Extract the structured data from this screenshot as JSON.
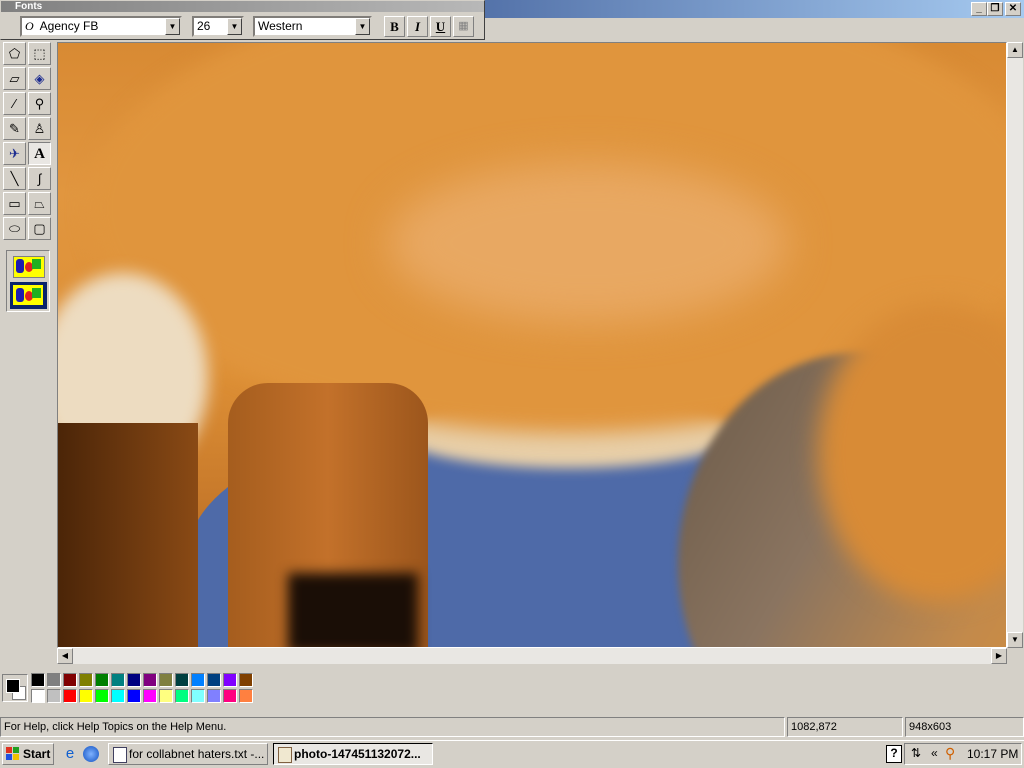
{
  "window": {
    "menu_first_letter": "F",
    "min_symbol": "_",
    "restore_symbol": "❐",
    "close_symbol": "✕"
  },
  "fonts_toolbar": {
    "title": "Fonts",
    "font_icon": "O",
    "font_name": "Agency FB",
    "font_size": "26",
    "script": "Western",
    "bold_label": "B",
    "italic_label": "I",
    "underline_label": "U"
  },
  "toolbox": {
    "tools": [
      {
        "name": "free-form-select-icon",
        "glyph": "⬠"
      },
      {
        "name": "rect-select-icon",
        "glyph": "⬚"
      },
      {
        "name": "eraser-icon",
        "glyph": "▱"
      },
      {
        "name": "fill-bucket-icon",
        "glyph": "◈"
      },
      {
        "name": "color-picker-icon",
        "glyph": "⁄"
      },
      {
        "name": "magnifier-icon",
        "glyph": "⚲"
      },
      {
        "name": "pencil-icon",
        "glyph": "✎"
      },
      {
        "name": "brush-icon",
        "glyph": "♙"
      },
      {
        "name": "airbrush-icon",
        "glyph": "✈"
      },
      {
        "name": "text-icon",
        "glyph": "A"
      },
      {
        "name": "line-icon",
        "glyph": "╲"
      },
      {
        "name": "curve-icon",
        "glyph": "∫"
      },
      {
        "name": "rectangle-icon",
        "glyph": "▭"
      },
      {
        "name": "polygon-icon",
        "glyph": "⏢"
      },
      {
        "name": "ellipse-icon",
        "glyph": "⬭"
      },
      {
        "name": "rounded-rect-icon",
        "glyph": "▢"
      }
    ],
    "active_tool": "text-icon"
  },
  "colors": {
    "primary": "#000000",
    "secondary": "#ffffff",
    "palette_row1": [
      "#000000",
      "#808080",
      "#800000",
      "#808000",
      "#008000",
      "#008080",
      "#000080",
      "#800080",
      "#808040",
      "#004040",
      "#0080ff",
      "#004080",
      "#8000ff",
      "#804000"
    ],
    "palette_row2": [
      "#ffffff",
      "#c0c0c0",
      "#ff0000",
      "#ffff00",
      "#00ff00",
      "#00ffff",
      "#0000ff",
      "#ff00ff",
      "#ffff80",
      "#00ff80",
      "#80ffff",
      "#8080ff",
      "#ff0080",
      "#ff8040"
    ]
  },
  "status_bar": {
    "help_text": "For Help, click Help Topics on the Help Menu.",
    "cursor_pos": "1082,872",
    "image_size": "948x603"
  },
  "taskbar": {
    "start_label": "Start",
    "buttons": [
      {
        "label": "for collabnet haters.txt -...",
        "active": false
      },
      {
        "label": "photo-147451132072...",
        "active": true
      }
    ],
    "clock": "10:17 PM",
    "tray_chevron": "«"
  }
}
